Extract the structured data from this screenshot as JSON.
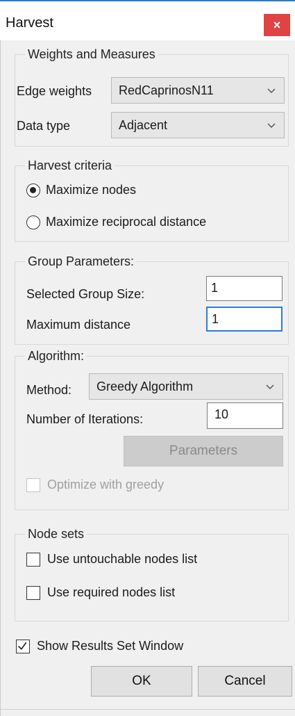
{
  "window": {
    "title": "Harvest",
    "close_glyph": "×"
  },
  "weights": {
    "legend": "Weights and Measures",
    "edge_label": "Edge weights",
    "edge_value": "RedCaprinosN11",
    "type_label": "Data type",
    "type_value": "Adjacent"
  },
  "criteria": {
    "legend": "Harvest criteria",
    "option1": "Maximize nodes",
    "option2": "Maximize reciprocal distance",
    "selected": "Maximize nodes"
  },
  "group": {
    "legend": "Group Parameters:",
    "size_label": "Selected Group Size:",
    "size_value": "1",
    "dist_label": "Maximum distance",
    "dist_value": "1"
  },
  "algorithm": {
    "legend": "Algorithm:",
    "method_label": "Method:",
    "method_value": "Greedy Algorithm",
    "iter_label": "Number of Iterations:",
    "iter_value": "10",
    "params_label": "Parameters",
    "optimize_label": "Optimize with greedy"
  },
  "nodesets": {
    "legend": "Node sets",
    "untouchable_label": "Use untouchable nodes list",
    "required_label": "Use required nodes list"
  },
  "footer": {
    "show_results_label": "Show Results Set Window",
    "show_results_checked": true,
    "ok_label": "OK",
    "cancel_label": "Cancel"
  },
  "colors": {
    "accent": "#2b7bd6",
    "close": "#e04343",
    "dialog_bg": "#f0f0f0"
  },
  "icons": [
    "close-icon",
    "chevron-down-icon",
    "check-icon"
  ]
}
